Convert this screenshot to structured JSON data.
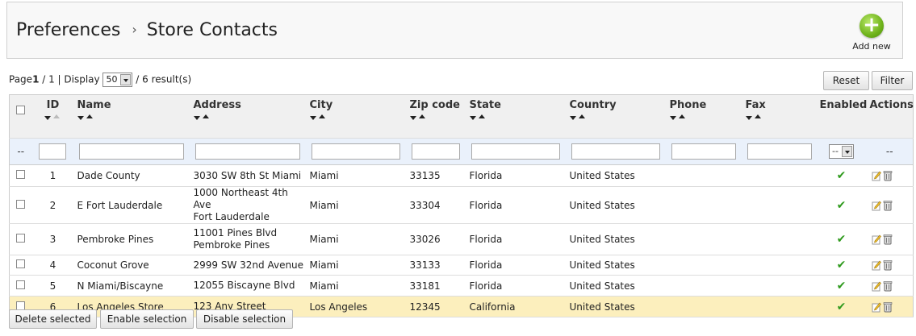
{
  "breadcrumb": {
    "parent": "Preferences",
    "separator": "›",
    "current": "Store Contacts"
  },
  "add_new_label": "Add new",
  "paging": {
    "page_label": "Page",
    "page_current": "1",
    "page_rest": " / 1 | Display ",
    "per_page": "50",
    "results": " / 6 result(s)"
  },
  "buttons": {
    "reset": "Reset",
    "filter": "Filter",
    "delete_selected": "Delete selected",
    "enable_selection": "Enable selection",
    "disable_selection": "Disable selection"
  },
  "columns": {
    "id": "ID",
    "name": "Name",
    "address": "Address",
    "city": "City",
    "zip": "Zip code",
    "state": "State",
    "country": "Country",
    "phone": "Phone",
    "fax": "Fax",
    "enabled": "Enabled",
    "actions": "Actions"
  },
  "filter": {
    "dash": "--",
    "enabled_select": "--",
    "actions_dash": "--"
  },
  "rows": [
    {
      "id": "1",
      "name": "Dade County",
      "address1": "3030 SW 8th St Miami",
      "address2": "",
      "city": "Miami",
      "zip": "33135",
      "state": "Florida",
      "country": "United States",
      "phone": "",
      "fax": ""
    },
    {
      "id": "2",
      "name": "E Fort Lauderdale",
      "address1": "1000 Northeast 4th Ave",
      "address2": "Fort Lauderdale",
      "city": "Miami",
      "zip": "33304",
      "state": "Florida",
      "country": "United States",
      "phone": "",
      "fax": ""
    },
    {
      "id": "3",
      "name": "Pembroke Pines",
      "address1": "11001 Pines Blvd",
      "address2": "Pembroke Pines",
      "city": "Miami",
      "zip": "33026",
      "state": "Florida",
      "country": "United States",
      "phone": "",
      "fax": ""
    },
    {
      "id": "4",
      "name": "Coconut Grove",
      "address1": "2999 SW 32nd Avenue",
      "address2": "",
      "city": "Miami",
      "zip": "33133",
      "state": "Florida",
      "country": "United States",
      "phone": "",
      "fax": ""
    },
    {
      "id": "5",
      "name": "N Miami/Biscayne",
      "address1": "12055 Biscayne Blvd",
      "address2": "",
      "city": "Miami",
      "zip": "33181",
      "state": "Florida",
      "country": "United States",
      "phone": "",
      "fax": ""
    },
    {
      "id": "6",
      "name": "Los Angeles Store",
      "address1": "123 Any Street",
      "address2": "",
      "city": "Los Angeles",
      "zip": "12345",
      "state": "California",
      "country": "United States",
      "phone": "",
      "fax": ""
    }
  ],
  "colors": {
    "highlight_row": "#fcefbd",
    "filter_row": "#eaf1fb",
    "enabled_check": "#2f9a1d",
    "add_button": "#6fb31b"
  }
}
